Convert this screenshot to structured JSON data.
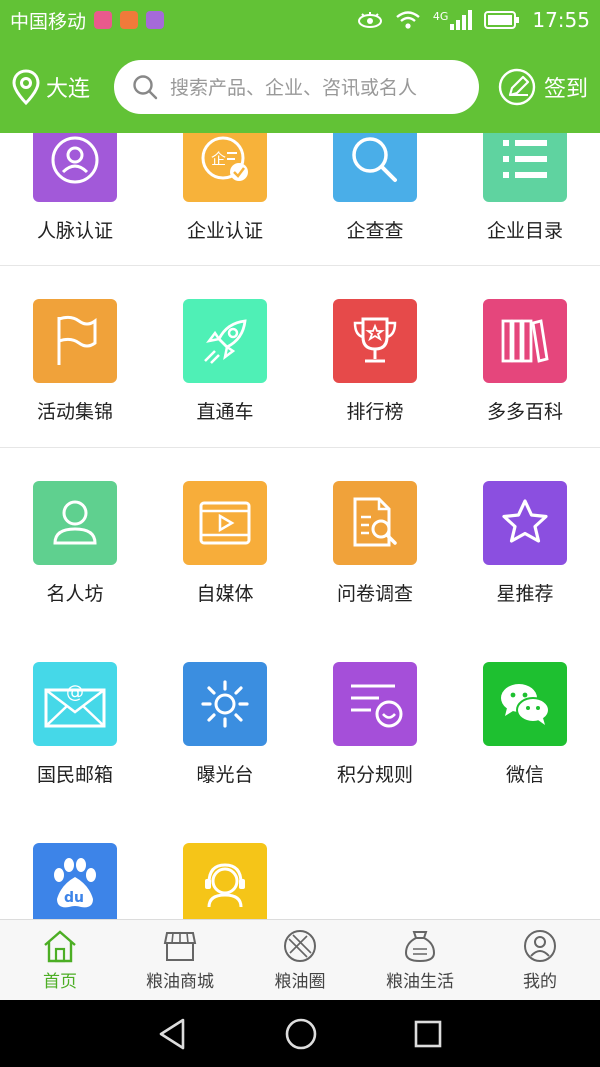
{
  "status_bar": {
    "carrier": "中国移动",
    "network": "4G",
    "time": "17:55"
  },
  "header": {
    "location": "大连",
    "search_placeholder": "搜索产品、企业、咨讯或名人",
    "checkin_label": "签到"
  },
  "grid": {
    "rows": [
      [
        {
          "label": "人脉认证",
          "icon": "contact-icon",
          "color": "#a259d9"
        },
        {
          "label": "企业认证",
          "icon": "enterprise-badge-icon",
          "color": "#f7b23a"
        },
        {
          "label": "企查查",
          "icon": "magnifier-icon",
          "color": "#4aaee8"
        },
        {
          "label": "企业目录",
          "icon": "list-icon",
          "color": "#5fd3a0"
        }
      ],
      [
        {
          "label": "活动集锦",
          "icon": "flag-icon",
          "color": "#f0a23a"
        },
        {
          "label": "直通车",
          "icon": "rocket-icon",
          "color": "#4ff0b6"
        },
        {
          "label": "排行榜",
          "icon": "trophy-icon",
          "color": "#e64a4a"
        },
        {
          "label": "多多百科",
          "icon": "books-icon",
          "color": "#e5467c"
        }
      ],
      [
        {
          "label": "名人坊",
          "icon": "person-icon",
          "color": "#5fd08f"
        },
        {
          "label": "自媒体",
          "icon": "video-icon",
          "color": "#f7ad3a"
        },
        {
          "label": "问卷调查",
          "icon": "survey-icon",
          "color": "#f0a23a"
        },
        {
          "label": "星推荐",
          "icon": "star-icon",
          "color": "#8b4fe0"
        }
      ],
      [
        {
          "label": "国民邮箱",
          "icon": "mail-icon",
          "color": "#45d8e8"
        },
        {
          "label": "曝光台",
          "icon": "sun-icon",
          "color": "#3b8ee0"
        },
        {
          "label": "积分规则",
          "icon": "rules-icon",
          "color": "#a54fd9"
        },
        {
          "label": "微信",
          "icon": "wechat-icon",
          "color": "#1ec030"
        }
      ],
      [
        {
          "label": "",
          "icon": "baidu-icon",
          "color": "#3d84e8"
        },
        {
          "label": "",
          "icon": "customer-service-icon",
          "color": "#f5c518"
        }
      ]
    ]
  },
  "bottom_nav": [
    {
      "label": "首页",
      "icon": "home-icon",
      "active": true
    },
    {
      "label": "粮油商城",
      "icon": "store-icon",
      "active": false
    },
    {
      "label": "粮油圈",
      "icon": "circle-icon",
      "active": false
    },
    {
      "label": "粮油生活",
      "icon": "sack-icon",
      "active": false
    },
    {
      "label": "我的",
      "icon": "user-icon",
      "active": false
    }
  ]
}
